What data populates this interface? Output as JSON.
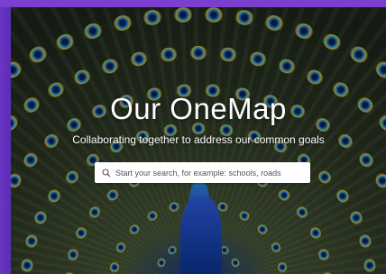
{
  "hero": {
    "title": "Our OneMap",
    "subtitle": "Collaborating together to address our common goals"
  },
  "search": {
    "placeholder": "Start your search, for example: schools, roads",
    "icon": "search-icon"
  },
  "colors": {
    "frame_purple": "#7b3fd0",
    "text_white": "#ffffff",
    "search_bg": "#ffffff"
  }
}
